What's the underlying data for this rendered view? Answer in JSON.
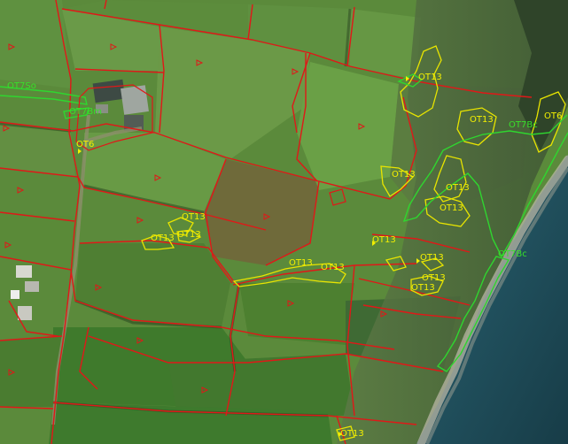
{
  "map": {
    "type": "aerial habitat survey overlay",
    "colors": {
      "field_boundary": "#e01818",
      "habitat_yellow": "#e8e400",
      "habitat_green": "#2fd62f",
      "sea": "#1f4f5c",
      "pasture": "#5e8a3c"
    },
    "labels": [
      {
        "id": "ot7so",
        "text": "OT7So",
        "color": "#38e02a"
      },
      {
        "id": "ot7bm",
        "text": "OT7Bm",
        "color": "#38e02a"
      },
      {
        "id": "ot6-west",
        "text": "OT6",
        "color": "#f4f000"
      },
      {
        "id": "ot13-ne",
        "text": "OT13",
        "color": "#f4f000"
      },
      {
        "id": "ot13-east",
        "text": "OT13",
        "color": "#f4f000"
      },
      {
        "id": "ot7-coast",
        "text": "OT7Bc",
        "color": "#38e02a"
      },
      {
        "id": "ot6-east",
        "text": "OT6",
        "color": "#f4f000"
      },
      {
        "id": "ot13-gorse",
        "text": "OT13",
        "color": "#f4f000"
      },
      {
        "id": "ot13-mid1",
        "text": "OT13",
        "color": "#f4f000"
      },
      {
        "id": "ot13-mid2",
        "text": "OT13",
        "color": "#f4f000"
      },
      {
        "id": "ot13-left1",
        "text": "OT13",
        "color": "#f4f000"
      },
      {
        "id": "ot13-left2",
        "text": "OT13",
        "color": "#f4f000"
      },
      {
        "id": "ot13-center",
        "text": "OT13",
        "color": "#f4f000"
      },
      {
        "id": "ot13-r1",
        "text": "OT13",
        "color": "#f4f000"
      },
      {
        "id": "ot13-bottom1",
        "text": "OT13",
        "color": "#f4f000"
      },
      {
        "id": "ot13-bottom2",
        "text": "OT13",
        "color": "#f4f000"
      },
      {
        "id": "ot13-sr1",
        "text": "OT13",
        "color": "#f4f000"
      },
      {
        "id": "ot13-sr2",
        "text": "OT13",
        "color": "#f4f000"
      },
      {
        "id": "ot13-sr3",
        "text": "OT13",
        "color": "#f4f000"
      },
      {
        "id": "ot13-foot",
        "text": "OT13",
        "color": "#f4f000"
      },
      {
        "id": "ot7bc-south",
        "text": "OT7Bc",
        "color": "#38e02a"
      }
    ]
  }
}
